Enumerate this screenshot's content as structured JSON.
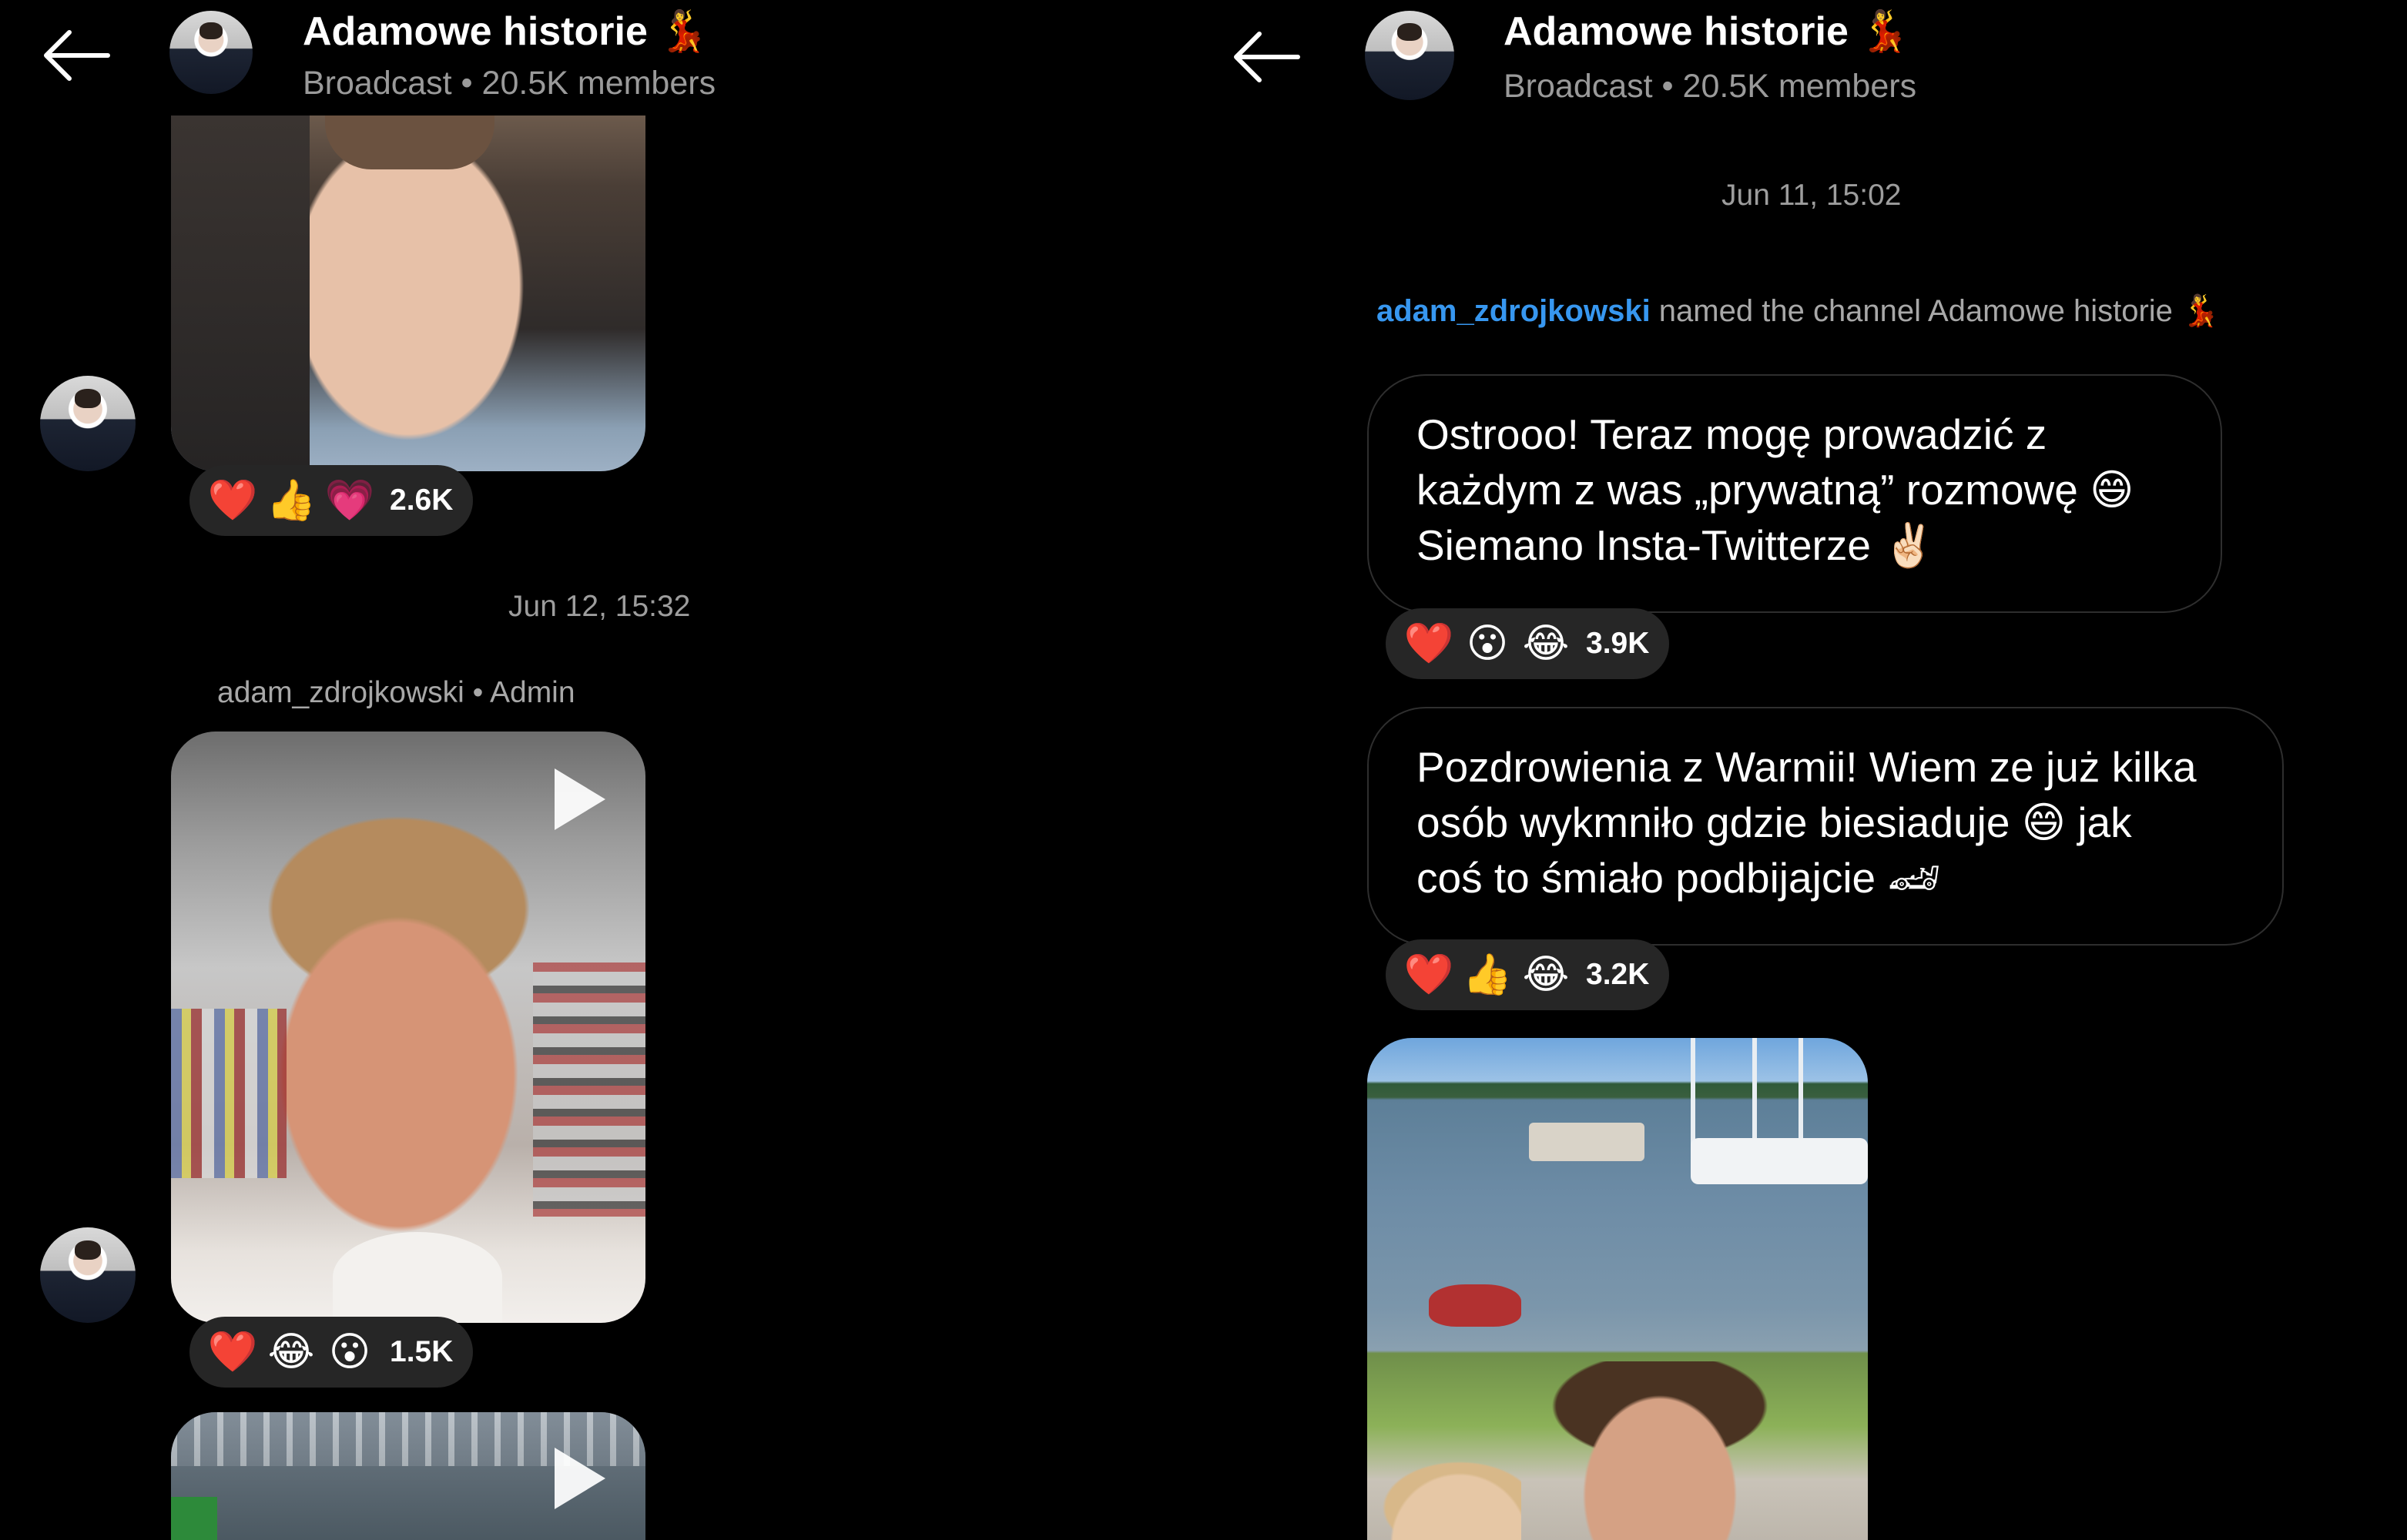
{
  "left": {
    "header": {
      "title": "Adamowe historie 💃",
      "subtitle": "Broadcast • 20.5K members"
    },
    "reactions1": {
      "e1": "❤️",
      "e2": "👍",
      "e3": "💗",
      "count": "2.6K"
    },
    "timestamp": "Jun 12, 15:32",
    "sender": {
      "name": "adam_zdrojkowski",
      "role": " • Admin"
    },
    "reactions2": {
      "e1": "❤️",
      "e2": "😂",
      "e3": "😮",
      "count": "1.5K"
    }
  },
  "right": {
    "header": {
      "title": "Adamowe historie 💃",
      "subtitle": "Broadcast • 20.5K members"
    },
    "timestamp": "Jun 11, 15:02",
    "system": {
      "user": "adam_zdrojkowski",
      "text": " named the channel Adamowe historie 💃"
    },
    "message1": {
      "line1": "Ostrooo! Teraz mogę prowadzić z",
      "line2": "każdym z was „prywatną” rozmowę 😄",
      "line3": "Siemano Insta-Twitterze ✌🏻"
    },
    "reactions1": {
      "e1": "❤️",
      "e2": "😮",
      "e3": "😂",
      "count": "3.9K"
    },
    "message2": {
      "line1": "Pozdrowienia z Warmii! Wiem ze już kilka",
      "line2": "osób wykmniło gdzie biesiaduje 😄 jak",
      "line3": "coś to śmiało podbijajcie 🏎"
    },
    "reactions2": {
      "e1": "❤️",
      "e2": "👍",
      "e3": "😂",
      "count": "3.2K"
    }
  }
}
